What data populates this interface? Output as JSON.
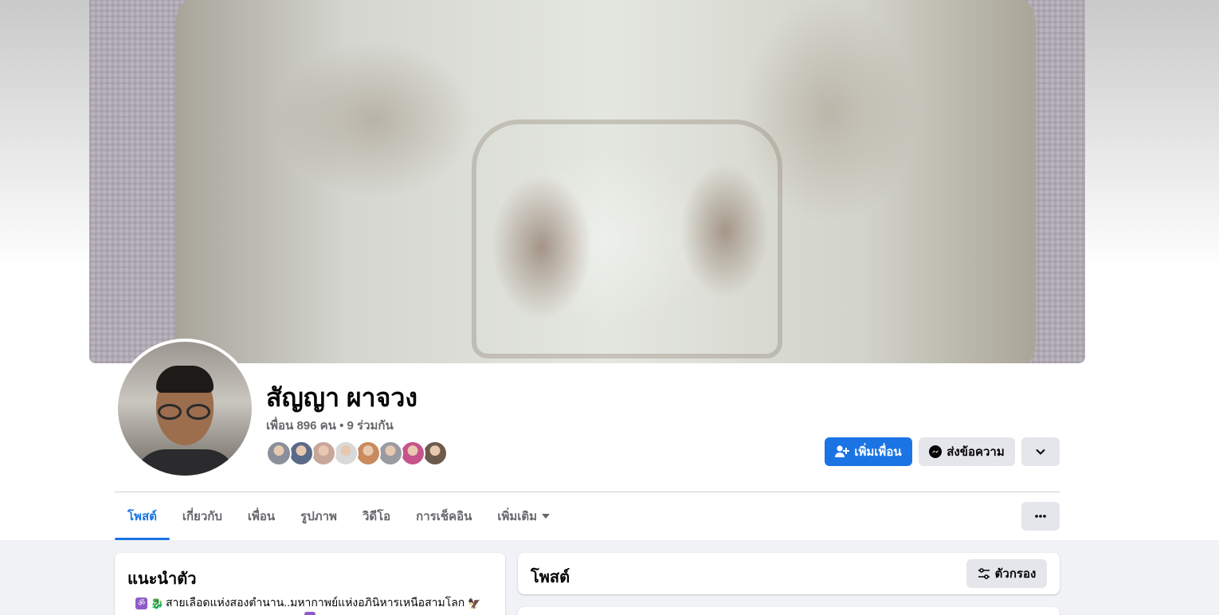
{
  "profile": {
    "name": "สัญญา ผาจวง",
    "friends_summary": "เพื่อน 896 คน • 9 ร่วมกัน",
    "mutual_friend_colors": [
      "#8a8f99",
      "#5a6a88",
      "#c7a79a",
      "#d9d9d9",
      "#c98a5e",
      "#9a9aa2",
      "#c7538b",
      "#6d5a4a"
    ]
  },
  "actions": {
    "add_friend": "เพิ่มเพื่อน",
    "message": "ส่งข้อความ"
  },
  "tabs": [
    {
      "label": "โพสต์",
      "active": true
    },
    {
      "label": "เกี่ยวกับ",
      "active": false
    },
    {
      "label": "เพื่อน",
      "active": false
    },
    {
      "label": "รูปภาพ",
      "active": false
    },
    {
      "label": "วิดีโอ",
      "active": false
    },
    {
      "label": "การเช็คอิน",
      "active": false
    },
    {
      "label": "เพิ่มเติม",
      "active": false
    }
  ],
  "intro": {
    "title": "แนะนำตัว",
    "bio": "สายเลือดแห่งสองตำนาน..มหากาพย์แห่งอภินิหารเหนือสามโลก"
  },
  "posts_section": {
    "title": "โพสต์",
    "filter_label": "ตัวกรอง"
  },
  "colors": {
    "accent": "#1b74e4",
    "secondary_button": "#e4e6eb",
    "page_background": "#f0f2f5"
  }
}
